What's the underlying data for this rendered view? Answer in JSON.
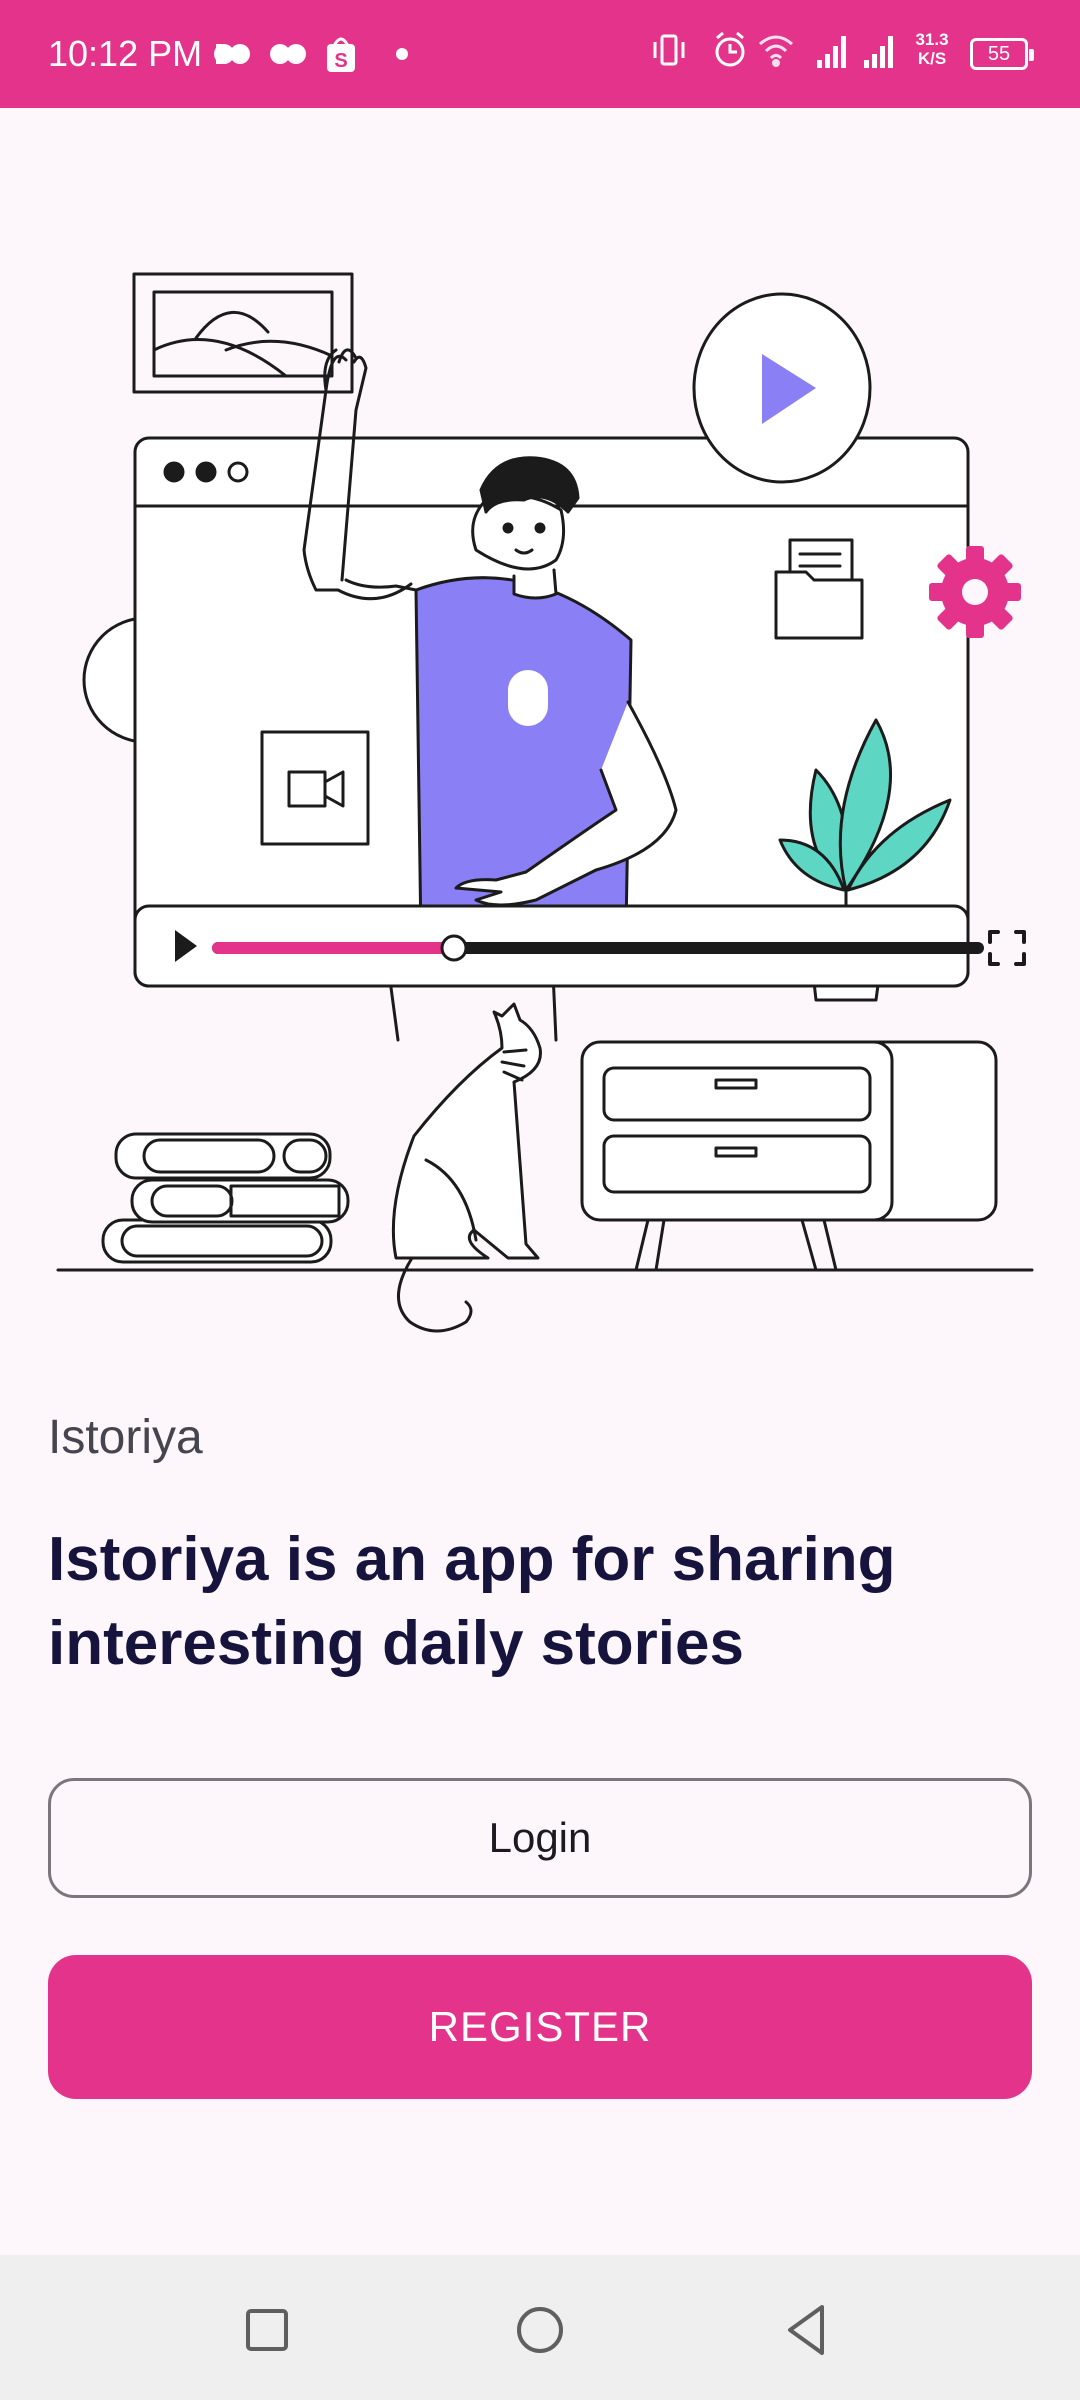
{
  "status_bar": {
    "time": "10:12 PM",
    "speed_value": "31.3",
    "speed_unit": "K/S",
    "battery": "55",
    "icons_left": [
      "message-icon",
      "message-icon",
      "shop-icon",
      "dot-icon"
    ],
    "icons_right": [
      "vibrate-icon",
      "alarm-icon",
      "wifi-icon",
      "signal-icon",
      "signal-icon",
      "battery-icon"
    ]
  },
  "hero": {
    "illustration": "video-streaming-illustration",
    "video_progress": 0.3
  },
  "content": {
    "app_name": "Istoriya",
    "headline": "Istoriya is an app for sharing interesting daily stories"
  },
  "actions": {
    "login_label": "Login",
    "register_label": "REGISTER"
  },
  "colors": {
    "accent": "#e4338a",
    "purple": "#8b7ff5",
    "teal": "#5dd6c4",
    "text_dark": "#16133d"
  },
  "nav_bar": {
    "buttons": [
      "recents-icon",
      "home-icon",
      "back-icon"
    ]
  }
}
